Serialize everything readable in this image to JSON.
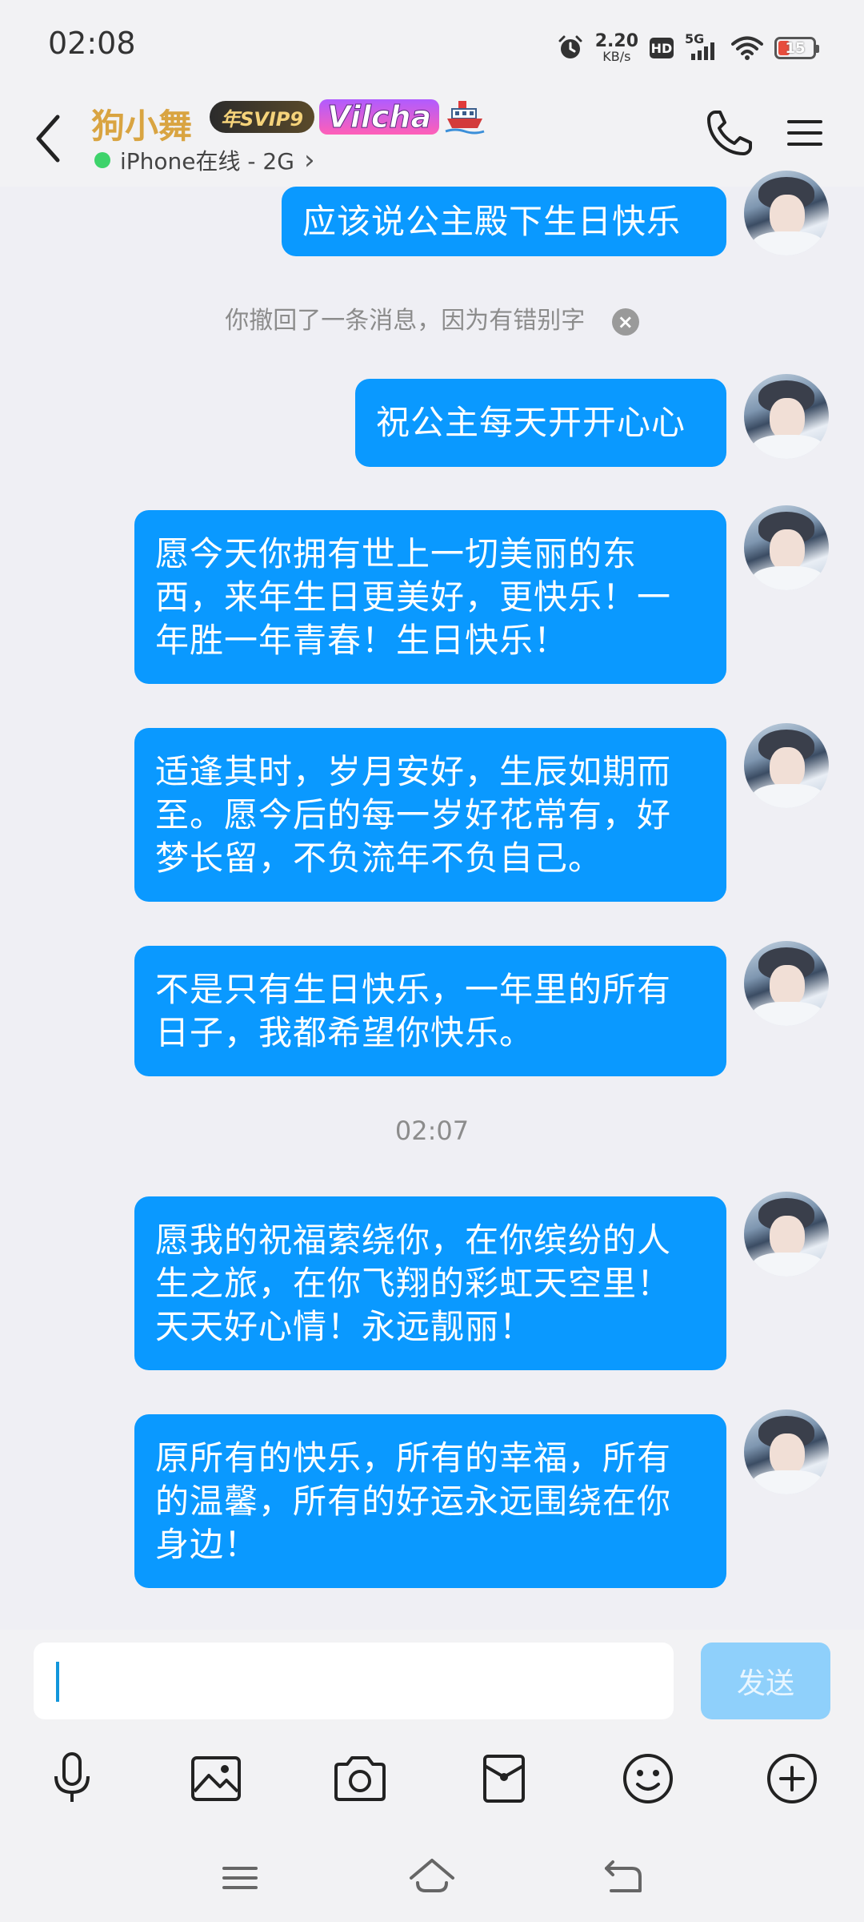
{
  "status_bar": {
    "time": "02:08",
    "net_speed_value": "2.20",
    "net_speed_unit": "KB/s",
    "hd": "HD",
    "signal": "5G",
    "battery_level": "15"
  },
  "header": {
    "contact_name": "狗小舞",
    "svip_badge": "年SVIP9",
    "vip_logo": "Vilcha",
    "online_status": "iPhone在线 - 2G",
    "online_chevron": "›"
  },
  "messages": [
    {
      "type": "sent",
      "text": "应该说公主殿下生日快乐"
    },
    {
      "type": "notice",
      "text": "你撤回了一条消息，因为有错别字"
    },
    {
      "type": "sent",
      "text": "祝公主每天开开心心"
    },
    {
      "type": "sent",
      "lines": [
        "愿今天你拥有世上一切美丽的东",
        "西，来年生日更美好，更快乐！一",
        "年胜一年青春！生日快乐！"
      ]
    },
    {
      "type": "sent",
      "lines": [
        "适逢其时，岁月安好，生辰如期而",
        "至。愿今后的每一岁好花常有，好",
        "梦长留，不负流年不负自己。"
      ]
    },
    {
      "type": "sent",
      "lines": [
        "不是只有生日快乐，一年里的所有",
        "日子，我都希望你快乐。"
      ]
    },
    {
      "type": "time",
      "text": "02:07"
    },
    {
      "type": "sent",
      "lines": [
        "愿我的祝福萦绕你，在你缤纷的人",
        "生之旅，在你飞翔的彩虹天空里！",
        "天天好心情！永远靓丽！"
      ]
    },
    {
      "type": "sent",
      "lines": [
        "原所有的快乐，所有的幸福，所有",
        "的温馨，所有的好运永远围绕在你",
        "身边！"
      ]
    }
  ],
  "recall_close": "×",
  "input": {
    "value": "",
    "send_label": "发送"
  },
  "toolbar_icons": [
    "microphone-icon",
    "image-icon",
    "camera-icon",
    "red-packet-icon",
    "emoji-icon",
    "plus-icon"
  ],
  "colors": {
    "bubble": "#0a99ff",
    "name": "#d9a441",
    "online": "#3ed36b",
    "send_disabled": "#8fd0fb"
  }
}
